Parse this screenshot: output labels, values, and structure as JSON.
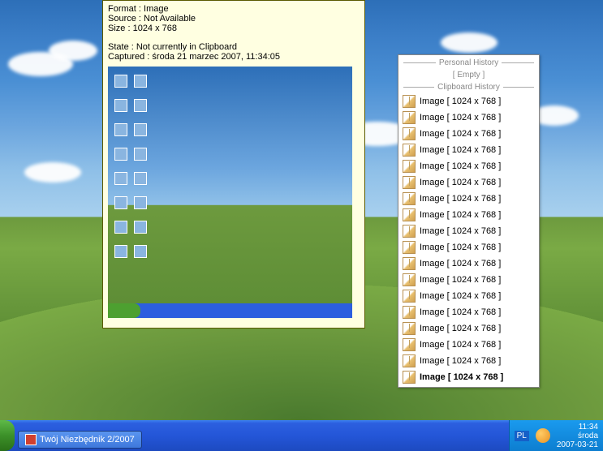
{
  "info": {
    "format_label": "Format : ",
    "format_value": "Image",
    "source_label": "Source : ",
    "source_value": "Not Available",
    "size_label": "Size : ",
    "size_value": "1024 x 768",
    "state_label": "State : ",
    "state_value": "Not currently in Clipboard",
    "captured_label": "Captured : ",
    "captured_value": "środa 21 marzec 2007, 11:34:05"
  },
  "history": {
    "personal_header": "Personal History",
    "empty": "[  Empty  ]",
    "clipboard_header": "Clipboard History",
    "items": [
      {
        "label": "Image [ 1024 x 768 ]",
        "active": false
      },
      {
        "label": "Image [ 1024 x 768 ]",
        "active": false
      },
      {
        "label": "Image [ 1024 x 768 ]",
        "active": false
      },
      {
        "label": "Image [ 1024 x 768 ]",
        "active": false
      },
      {
        "label": "Image [ 1024 x 768 ]",
        "active": false
      },
      {
        "label": "Image [ 1024 x 768 ]",
        "active": false
      },
      {
        "label": "Image [ 1024 x 768 ]",
        "active": false
      },
      {
        "label": "Image [ 1024 x 768 ]",
        "active": false
      },
      {
        "label": "Image [ 1024 x 768 ]",
        "active": false
      },
      {
        "label": "Image [ 1024 x 768 ]",
        "active": false
      },
      {
        "label": "Image [ 1024 x 768 ]",
        "active": false
      },
      {
        "label": "Image [ 1024 x 768 ]",
        "active": false
      },
      {
        "label": "Image [ 1024 x 768 ]",
        "active": false
      },
      {
        "label": "Image [ 1024 x 768 ]",
        "active": false
      },
      {
        "label": "Image [ 1024 x 768 ]",
        "active": false
      },
      {
        "label": "Image [ 1024 x 768 ]",
        "active": false
      },
      {
        "label": "Image [ 1024 x 768 ]",
        "active": false
      },
      {
        "label": "Image [ 1024 x 768 ]",
        "active": true
      }
    ]
  },
  "taskbar": {
    "app_name": "Twój Niezbędnik 2/2007",
    "lang": "PL",
    "time": "11:34",
    "day": "środa",
    "date": "2007-03-21"
  }
}
